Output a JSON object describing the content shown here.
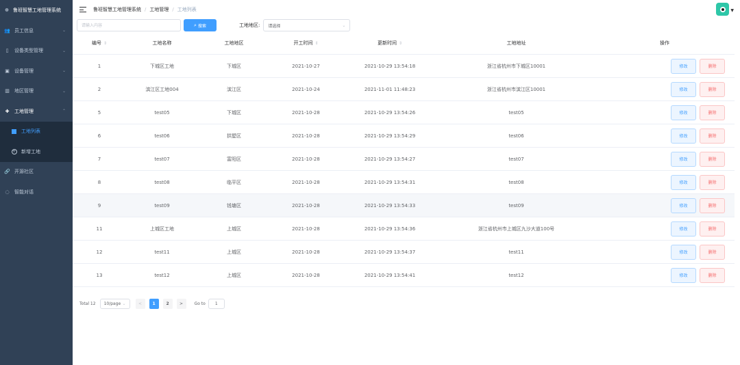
{
  "sidebar": {
    "brand": "鲁班智慧工地管理系统",
    "items": [
      {
        "label": "员工信息",
        "icon": "user-icon"
      },
      {
        "label": "设备类型管理",
        "icon": "device-type-icon"
      },
      {
        "label": "设备管理",
        "icon": "device-icon"
      },
      {
        "label": "地区管理",
        "icon": "region-icon"
      },
      {
        "label": "工地管理",
        "icon": "site-icon"
      }
    ],
    "sub_items": [
      {
        "label": "工地列表",
        "icon": "list-icon"
      },
      {
        "label": "新增工地",
        "icon": "add-circle-icon"
      }
    ],
    "bottom_items": [
      {
        "label": "开源社区",
        "icon": "link-icon"
      },
      {
        "label": "智能对话",
        "icon": "chat-icon"
      }
    ]
  },
  "header": {
    "breadcrumb": [
      "鲁班智慧工地管理系统",
      "工地管理",
      "工地列表"
    ]
  },
  "filters": {
    "search_placeholder": "请输入内容",
    "search_button": "搜索",
    "area_label": "工地地区:",
    "area_placeholder": "请选择"
  },
  "table": {
    "headers": [
      "编号",
      "工地名称",
      "工地地区",
      "开工时间",
      "更新时间",
      "工地地址",
      "操作"
    ],
    "edit_label": "修改",
    "delete_label": "删除",
    "rows": [
      {
        "id": "1",
        "name": "下城区工地",
        "area": "下城区",
        "start": "2021-10-27",
        "updated": "2021-10-29 13:54:18",
        "address": "浙江省杭州市下城区10001"
      },
      {
        "id": "2",
        "name": "滨江区工地004",
        "area": "滨江区",
        "start": "2021-10-24",
        "updated": "2021-11-01 11:48:23",
        "address": "浙江省杭州市滨江区10001"
      },
      {
        "id": "5",
        "name": "test05",
        "area": "下城区",
        "start": "2021-10-28",
        "updated": "2021-10-29 13:54:26",
        "address": "test05"
      },
      {
        "id": "6",
        "name": "test06",
        "area": "拱墅区",
        "start": "2021-10-28",
        "updated": "2021-10-29 13:54:29",
        "address": "test06"
      },
      {
        "id": "7",
        "name": "test07",
        "area": "富阳区",
        "start": "2021-10-28",
        "updated": "2021-10-29 13:54:27",
        "address": "test07"
      },
      {
        "id": "8",
        "name": "test08",
        "area": "临平区",
        "start": "2021-10-28",
        "updated": "2021-10-29 13:54:31",
        "address": "test08"
      },
      {
        "id": "9",
        "name": "test09",
        "area": "钱塘区",
        "start": "2021-10-28",
        "updated": "2021-10-29 13:54:33",
        "address": "test09"
      },
      {
        "id": "11",
        "name": "上城区工地",
        "area": "上城区",
        "start": "2021-10-28",
        "updated": "2021-10-29 13:54:36",
        "address": "浙江省杭州市上城区九沙大道100号"
      },
      {
        "id": "12",
        "name": "test11",
        "area": "上城区",
        "start": "2021-10-28",
        "updated": "2021-10-29 13:54:37",
        "address": "test11"
      },
      {
        "id": "13",
        "name": "test12",
        "area": "上城区",
        "start": "2021-10-28",
        "updated": "2021-10-29 13:54:41",
        "address": "test12"
      }
    ]
  },
  "pagination": {
    "total_text": "Total 12",
    "page_size": "10/page",
    "pages": [
      "1",
      "2"
    ],
    "current_page": "1",
    "goto_label": "Go to",
    "goto_value": "1"
  },
  "colors": {
    "sidebar_bg": "#304156",
    "primary": "#409eff",
    "danger": "#f56c6c"
  }
}
